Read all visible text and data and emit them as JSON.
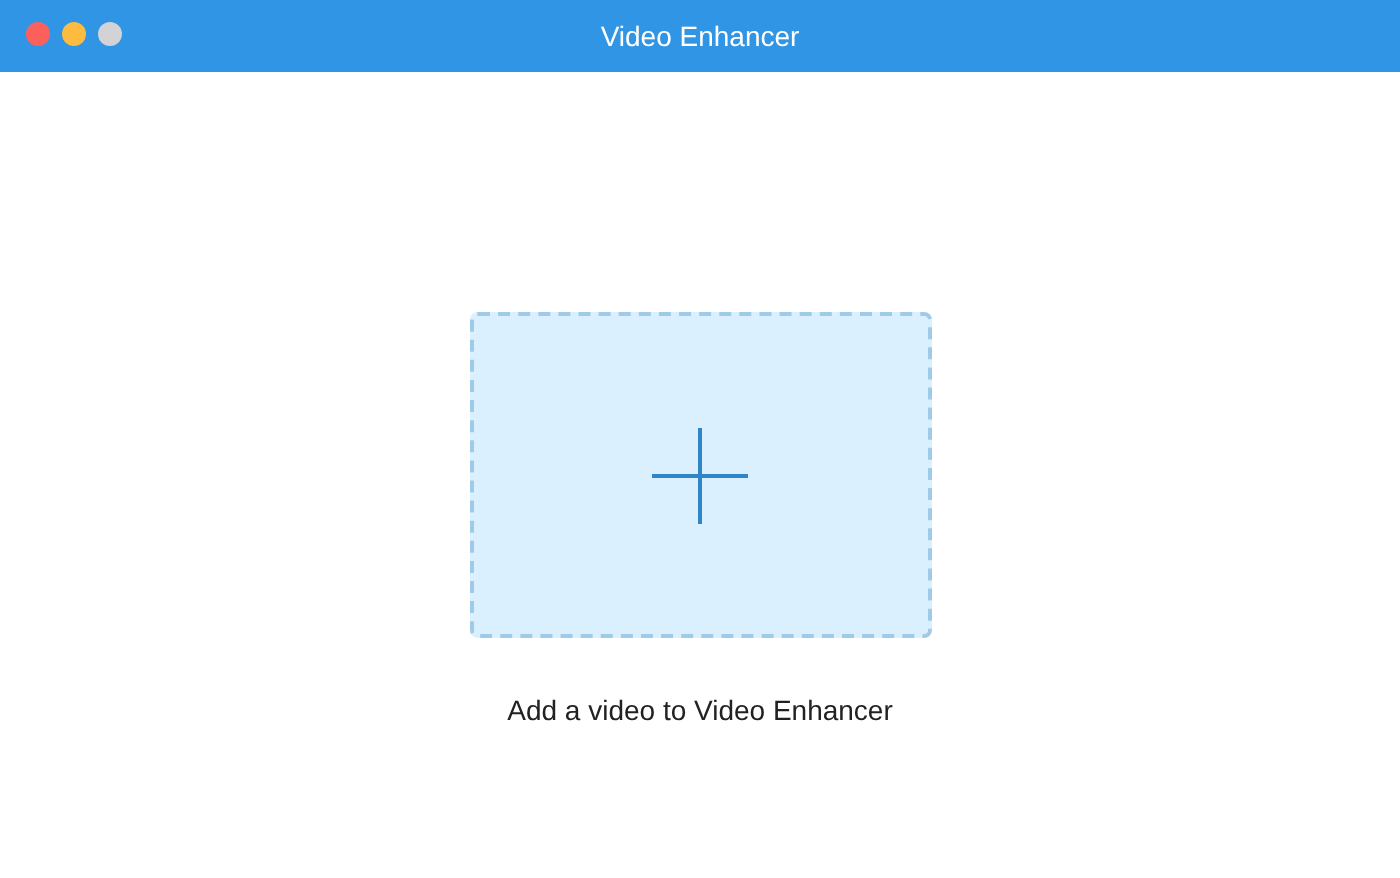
{
  "window": {
    "title": "Video Enhancer",
    "controls": [
      {
        "color": "#fc605c"
      },
      {
        "color": "#fdbc40"
      },
      {
        "color": "#d3d3d7"
      }
    ]
  },
  "drop_zone": {
    "caption": "Add a video to Video Enhancer"
  }
}
